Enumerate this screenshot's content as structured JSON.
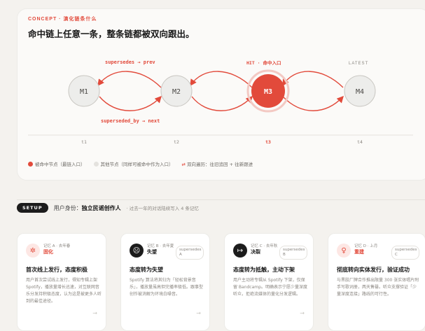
{
  "eyebrow": "CONCEPT · 演化链条什么",
  "headline": "命中链上任意一条，整条链都被双向跟出。",
  "chain": {
    "label_top": "supersedes → prev",
    "label_bottom": "superseded_by → next",
    "hit_label": "HIT · 命中入口",
    "latest_label": "LATEST",
    "nodes": [
      "M1",
      "M2",
      "M3",
      "M4"
    ],
    "times": [
      "t1",
      "t2",
      "t3",
      "t4"
    ]
  },
  "legend": {
    "hit": "被命中节点（最链入口）",
    "other": "其他节点（同样可被命中作为入口）",
    "bidir": "双向遍历：往旧追回 + 往新跟进"
  },
  "setup": {
    "pill": "SETUP",
    "label": "用户身份：",
    "value": "独立民谣创作人",
    "note": "· 过去一年的对话陆续写入 4 条记忆"
  },
  "cards": [
    {
      "icon": "✲",
      "meta": "记忆 A · 去年春",
      "state": "固化",
      "tag": "",
      "title": "首次线上发行，态度积极",
      "body": "用户首次尝试线上发行，得知专辑上架 Spotify，播放量增长迅速，对互联网音乐分发持积极态度，认为这是被更多人听到的最佳途径。"
    },
    {
      "icon": "☹",
      "meta": "记忆 B · 去年夏",
      "state": "失望",
      "tag": "supersedes A",
      "title": "态度转为失望",
      "body": "Spotify 算法将其归为「轻松背景音乐」，播放量虽高但完播率极低。跟事型创作被消解为环境白噪音。"
    },
    {
      "icon": "↦",
      "meta": "记忆 C · 去年秋",
      "state": "决裂",
      "tag": "supersedes B",
      "title": "态度转为抵触，主动下架",
      "body": "用户主动将专辑从 Spotify 下架，仅保留 Bandcamp。明确表示宁愿少量深度听众，拒绝流媒体的量化分发逻辑。"
    },
    {
      "icon": "♀",
      "meta": "记忆 D · 上月",
      "state": "重建",
      "tag": "supersedes C",
      "title": "彻底转向实体发行，验证成功",
      "body": "与黑胶厂牌合作推出限量 300 张实体唱片附手写歌词册，两天售罄。听众支撑验证「少量深度连接」路线的可行性。"
    }
  ],
  "colors": {
    "accent": "#e24a3b",
    "node_fill": "#ededeb",
    "node_stroke": "#c9c7c2"
  }
}
